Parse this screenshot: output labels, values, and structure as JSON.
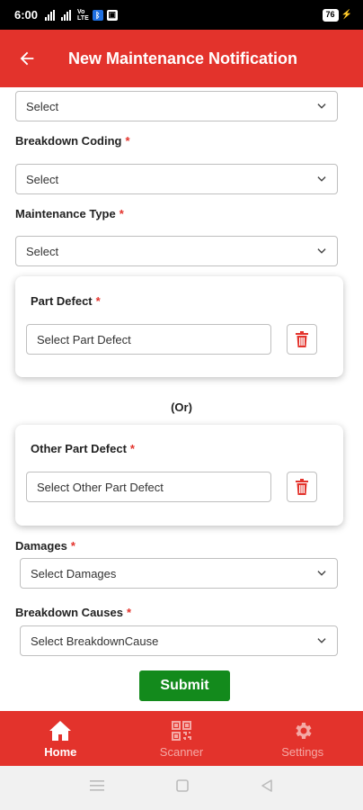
{
  "status_bar": {
    "time": "6:00",
    "vol_label_1": "Vo",
    "vol_label_2": "LTE",
    "battery": "76"
  },
  "app_bar": {
    "title": "New Maintenance Notification",
    "back_icon": "arrow-left-icon"
  },
  "form": {
    "top_select": {
      "value": "Select"
    },
    "breakdown_coding": {
      "label": "Breakdown Coding",
      "required": "*",
      "value": "Select"
    },
    "maintenance_type": {
      "label": "Maintenance Type",
      "required": "*",
      "value": "Select"
    },
    "part_defect": {
      "label": "Part Defect",
      "required": "*",
      "placeholder": "Select Part Defect"
    },
    "or_text": "(Or)",
    "other_part_defect": {
      "label": "Other Part Defect",
      "required": "*",
      "placeholder": "Select Other Part Defect"
    },
    "damages": {
      "label": "Damages",
      "required": "*",
      "value": "Select Damages"
    },
    "breakdown_causes": {
      "label": "Breakdown Causes",
      "required": "*",
      "value": "Select BreakdownCause"
    },
    "submit_label": "Submit"
  },
  "bottom_nav": [
    {
      "label": "Home",
      "icon": "home-icon",
      "active": true
    },
    {
      "label": "Scanner",
      "icon": "qr-code-icon",
      "active": false
    },
    {
      "label": "Settings",
      "icon": "gear-icon",
      "active": false
    }
  ],
  "colors": {
    "primary": "#e3332c",
    "submit": "#138a1c",
    "required": "#e3332c"
  }
}
